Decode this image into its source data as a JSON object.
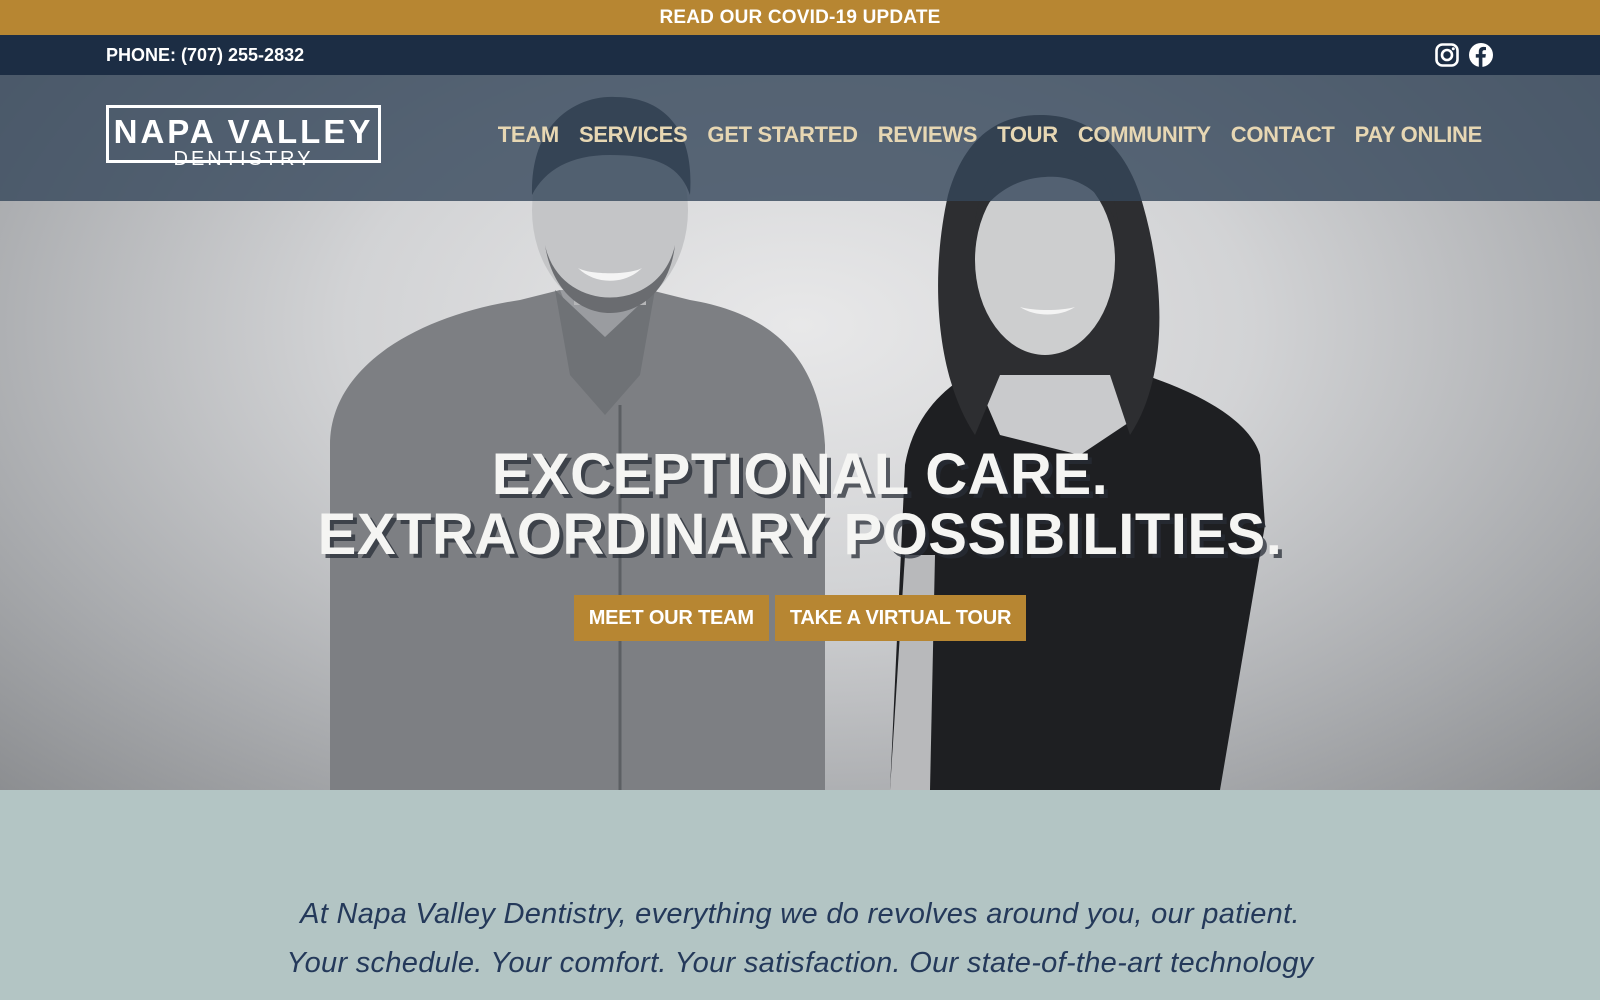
{
  "announcement": {
    "label": "READ OUR COVID-19 UPDATE"
  },
  "topbar": {
    "phone": "PHONE: (707) 255-2832",
    "social": [
      {
        "icon": "instagram-icon"
      },
      {
        "icon": "facebook-icon"
      }
    ]
  },
  "header": {
    "logo": {
      "line1": "NAPA VALLEY",
      "line2": "DENTISTRY"
    },
    "nav": [
      "TEAM",
      "SERVICES",
      "GET STARTED",
      "REVIEWS",
      "TOUR",
      "COMMUNITY",
      "CONTACT",
      "PAY ONLINE"
    ]
  },
  "hero": {
    "headline_line1": "EXCEPTIONAL CARE.",
    "headline_line2": "EXTRAORDINARY POSSIBILITIES.",
    "buttons": [
      "MEET OUR TEAM",
      "TAKE A VIRTUAL TOUR"
    ]
  },
  "intro": {
    "line1": "At Napa Valley Dentistry, everything we do revolves around you, our patient.",
    "line2": "Your schedule. Your comfort. Your satisfaction. Our state-of-the-art technology"
  },
  "colors": {
    "gold": "#b78632",
    "navy": "#1c2d44",
    "nav_text": "#e7d7b3",
    "intro_bg": "#b3c5c4",
    "intro_text": "#24395a"
  }
}
